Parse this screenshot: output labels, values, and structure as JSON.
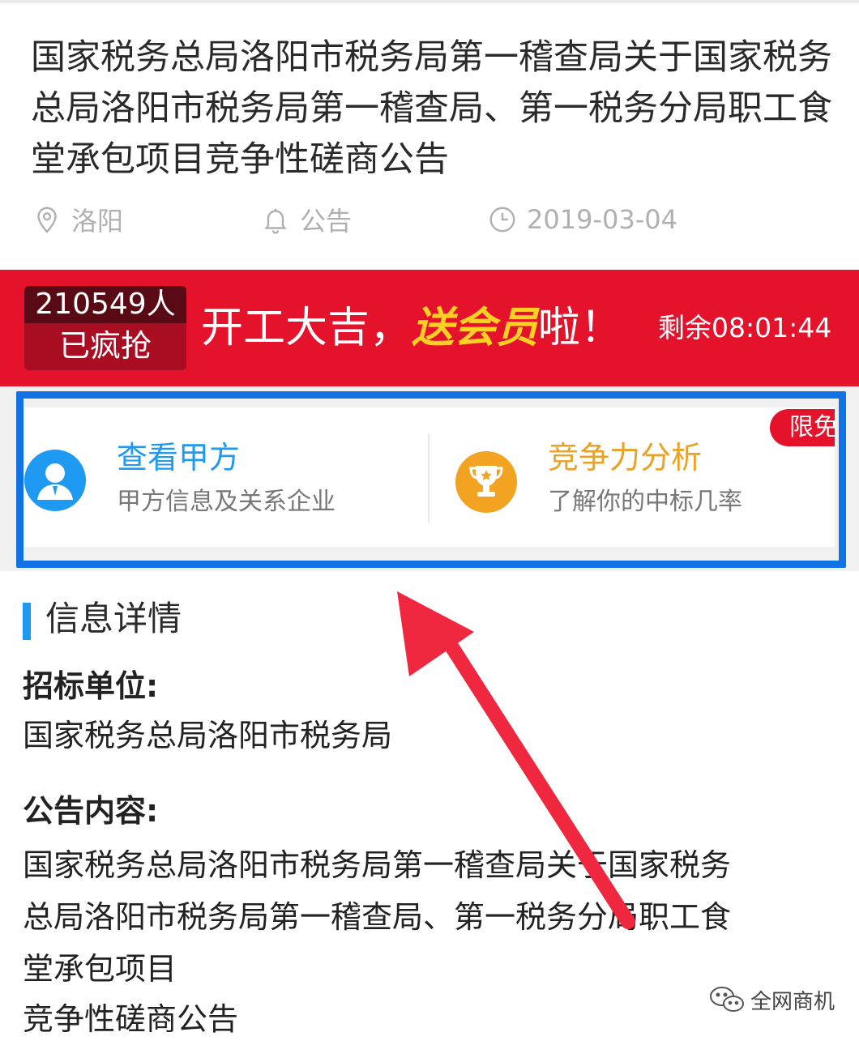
{
  "article": {
    "title": "国家税务总局洛阳市税务局第一稽查局关于国家税务总局洛阳市税务局第一稽查局、第一税务分局职工食堂承包项目竞争性磋商公告",
    "location": "洛阳",
    "type": "公告",
    "date": "2019-03-04"
  },
  "banner": {
    "count": "210549人",
    "count_label": "已疯抢",
    "promo_prefix": "开工大吉，",
    "promo_highlight": "送会员",
    "promo_suffix": "啦！",
    "countdown": "剩余08:01:44"
  },
  "features": {
    "ribbon": "限免",
    "left": {
      "title": "查看甲方",
      "subtitle": "甲方信息及关系企业"
    },
    "right": {
      "title": "竞争力分析",
      "subtitle": "了解你的中标几率"
    }
  },
  "details": {
    "section_title": "信息详情",
    "unit_label": "招标单位:",
    "unit_value": "国家税务总局洛阳市税务局",
    "content_label": "公告内容:",
    "content_lines": [
      "国家税务总局洛阳市税务局第一稽查局关于国家税务",
      "总局洛阳市税务局第一稽查局、第一税务分局职工食",
      "堂承包项目",
      "竞争性磋商公告"
    ]
  },
  "watermark": {
    "text": "全网商机"
  },
  "colors": {
    "banner_red": "#e5122c",
    "highlight_blue": "#1172e6",
    "accent_blue": "#1e9af2",
    "accent_orange": "#e8a226",
    "promo_yellow": "#ffd024"
  }
}
